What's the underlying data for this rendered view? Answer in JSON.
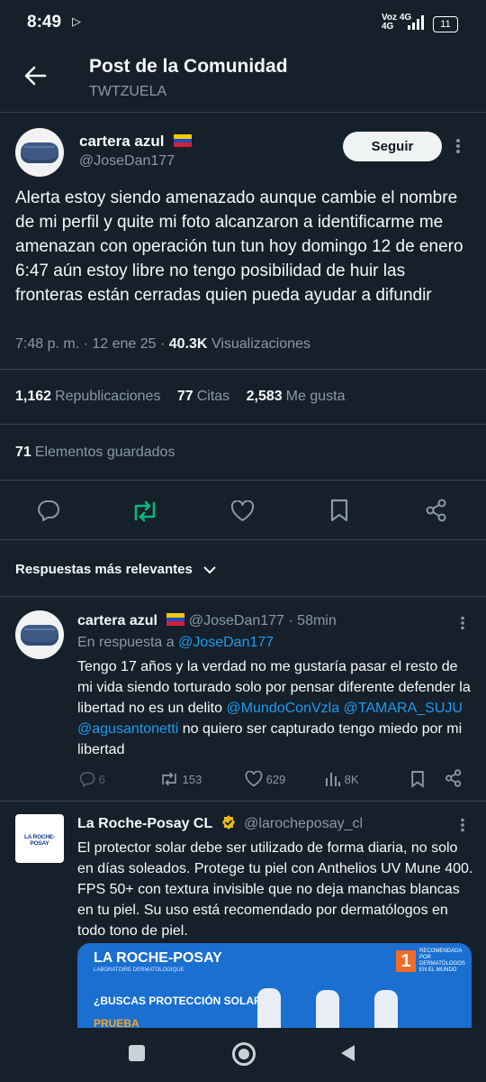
{
  "status_bar": {
    "time": "8:49",
    "network_top": "Voz 4G",
    "network_bottom": "4G",
    "battery": "11"
  },
  "header": {
    "title": "Post de la Comunidad",
    "subtitle": "TWTZUELA"
  },
  "post": {
    "author_name": "cartera azul",
    "author_handle": "@JoseDan177",
    "follow_label": "Seguir",
    "text": "Alerta estoy siendo amenazado aunque cambie el nombre de mi perfil y quite mi foto alcanzaron a identificarme me amenazan con operación tun tun hoy domingo 12 de enero 6:47 aún estoy libre no tengo posibilidad de huir las fronteras están cerradas quien pueda ayudar a difundir",
    "time": "7:48 p. m.",
    "date": "12 ene 25",
    "views_count": "40.3K",
    "views_label": "Visualizaciones",
    "reposts_count": "1,162",
    "reposts_label": "Republicaciones",
    "quotes_count": "77",
    "quotes_label": "Citas",
    "likes_count": "2,583",
    "likes_label": "Me gusta",
    "saved_count": "71",
    "saved_label": "Elementos guardados"
  },
  "replies_sort": {
    "label": "Respuestas más relevantes"
  },
  "reply": {
    "author_name": "cartera azul",
    "author_handle": "@JoseDan177",
    "age": "58min",
    "reply_to_prefix": "En respuesta a",
    "reply_to_handle": "@JoseDan177",
    "text_1": "Tengo 17 años y la verdad no me gustaría pasar el resto de mi vida siendo torturado solo por pensar diferente defender la libertad no es un delito",
    "mention_1": "@MundoConVzla",
    "mention_2": "@TAMARA_SUJU",
    "mention_3": "@agusantonetti",
    "text_2": "no quiero ser capturado tengo miedo por mi libertad",
    "replies": "6",
    "reposts": "153",
    "likes": "629",
    "views": "8K"
  },
  "ad": {
    "author_name": "La Roche-Posay CL",
    "author_handle": "@larocheposay_cl",
    "logo_text": "LA ROCHE-POSAY",
    "text": "El protector solar debe ser utilizado de forma diaria, no solo en días soleados. Protege tu piel con Anthelios UV Mune 400. FPS 50+ con textura invisible que no deja manchas blancas en tu piel. Su uso está recomendado por dermatólogos en todo tono de piel.",
    "image_brand": "LA ROCHE-POSAY",
    "image_sub": "LABORATOIRE DERMATOLOGIQUE",
    "image_badge_top": "RECOMENDADA POR DERMATÓLOGOS EN EL MUNDO",
    "image_question": "¿BUSCAS PROTECCIÓN SOLAR?",
    "image_cut_text": "PRUEBA"
  },
  "colors": {
    "background": "#15202b",
    "accent": "#1d9bf0",
    "repost_active": "#00ba7c",
    "muted": "#8b98a5"
  }
}
